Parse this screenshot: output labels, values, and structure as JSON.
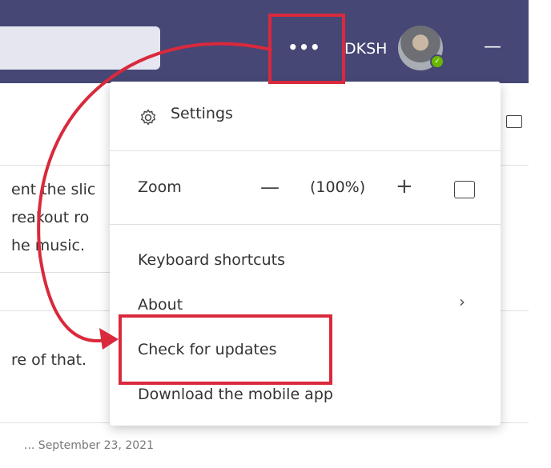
{
  "titlebar": {
    "more_label": "•••",
    "org_label": "DKSH",
    "presence": "✓",
    "minimize_label": "—"
  },
  "background": {
    "lines": [
      "ent the slic",
      "reakout ro",
      "he music.",
      "re of that."
    ],
    "footer_fragment": "... September 23, 2021"
  },
  "menu": {
    "settings_label": "Settings",
    "zoom_label": "Zoom",
    "zoom_minus": "—",
    "zoom_value": "(100%)",
    "zoom_plus": "+",
    "keyboard_label": "Keyboard shortcuts",
    "about_label": "About",
    "about_chevron": "›",
    "updates_label": "Check for updates",
    "mobile_label": "Download the mobile app"
  },
  "colors": {
    "titlebar": "#464775",
    "highlight": "#d9293c",
    "presence": "#6bb700"
  }
}
